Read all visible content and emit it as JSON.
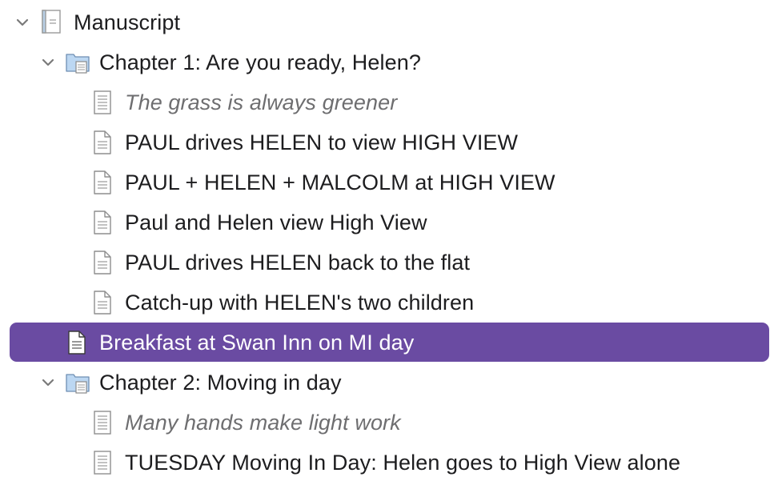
{
  "binder": {
    "root": {
      "label": "Manuscript",
      "icon": "manuscript-icon",
      "expanded": true
    },
    "chapter1": {
      "label": "Chapter 1: Are you ready, Helen?",
      "icon": "folder-icon",
      "expanded": true,
      "items": [
        {
          "label": "The grass is always greener",
          "icon": "document-lined-icon",
          "style": "italic"
        },
        {
          "label": "PAUL drives HELEN to view HIGH VIEW",
          "icon": "document-icon"
        },
        {
          "label": "PAUL + HELEN + MALCOLM at HIGH VIEW",
          "icon": "document-icon"
        },
        {
          "label": "Paul and Helen view High View",
          "icon": "document-icon"
        },
        {
          "label": "PAUL drives HELEN back to the flat",
          "icon": "document-icon"
        },
        {
          "label": "Catch-up with HELEN's two children",
          "icon": "document-icon"
        }
      ]
    },
    "selected_item": {
      "label": "Breakfast at Swan Inn on MI day",
      "icon": "document-icon"
    },
    "chapter2": {
      "label": "Chapter 2: Moving in day",
      "icon": "folder-icon",
      "expanded": true,
      "items": [
        {
          "label": "Many hands make light work",
          "icon": "document-lined-icon",
          "style": "italic"
        },
        {
          "label": "TUESDAY Moving In Day: Helen goes to High View alone",
          "icon": "document-lined-icon"
        }
      ]
    }
  },
  "colors": {
    "selection": "#6a4ba2",
    "text": "#1d1d1f",
    "italic_text": "#6e6e70",
    "folder": "#bcd7f2"
  }
}
